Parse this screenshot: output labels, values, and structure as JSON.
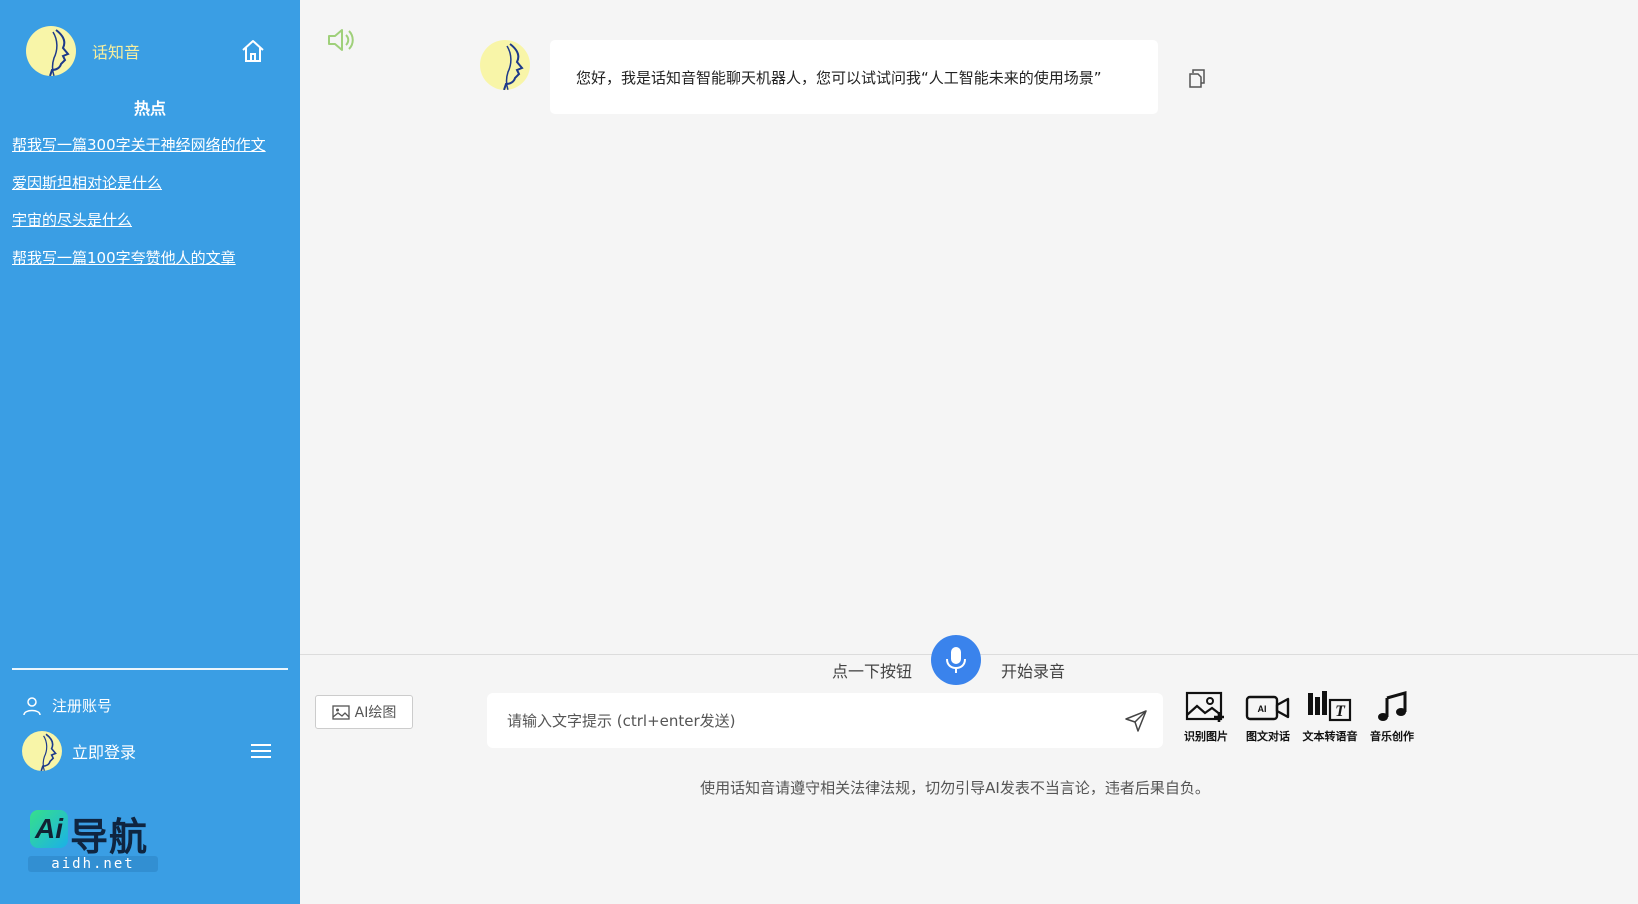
{
  "app": {
    "name": "话知音"
  },
  "sidebar": {
    "hot_title": "热点",
    "hot_items": [
      "帮我写一篇300字关于神经网络的作文",
      "爱因斯坦相对论是什么",
      "宇宙的尽头是什么",
      "帮我写一篇100字夸赞他人的文章"
    ],
    "register_label": "注册账号",
    "login_label": "立即登录",
    "logo_badge": "Ai",
    "logo_text": "导航",
    "logo_sub": "aidh.net"
  },
  "chat": {
    "messages": [
      {
        "role": "bot",
        "text": "您好，我是话知音智能聊天机器人，您可以试试问我“人工智能未来的使用场景”"
      }
    ]
  },
  "recorder": {
    "left_text": "点一下按钮",
    "right_text": "开始录音"
  },
  "composer": {
    "ai_draw_label": "AI绘图",
    "placeholder": "请输入文字提示 (ctrl+enter发送)",
    "value": ""
  },
  "tools": [
    {
      "label": "识别图片",
      "icon": "image-add-icon"
    },
    {
      "label": "图文对话",
      "icon": "ai-video-icon"
    },
    {
      "label": "文本转语音",
      "icon": "text-to-speech-icon"
    },
    {
      "label": "音乐创作",
      "icon": "music-note-icon"
    }
  ],
  "notice": "使用话知音请遵守相关法律法规，切勿引导AI发表不当言论，违者后果自负。",
  "colors": {
    "sidebar_bg": "#3a9ee4",
    "brand_yellow": "#f7ef9e",
    "mic_blue": "#3a83ec",
    "speaker_green": "#9fd07a"
  }
}
